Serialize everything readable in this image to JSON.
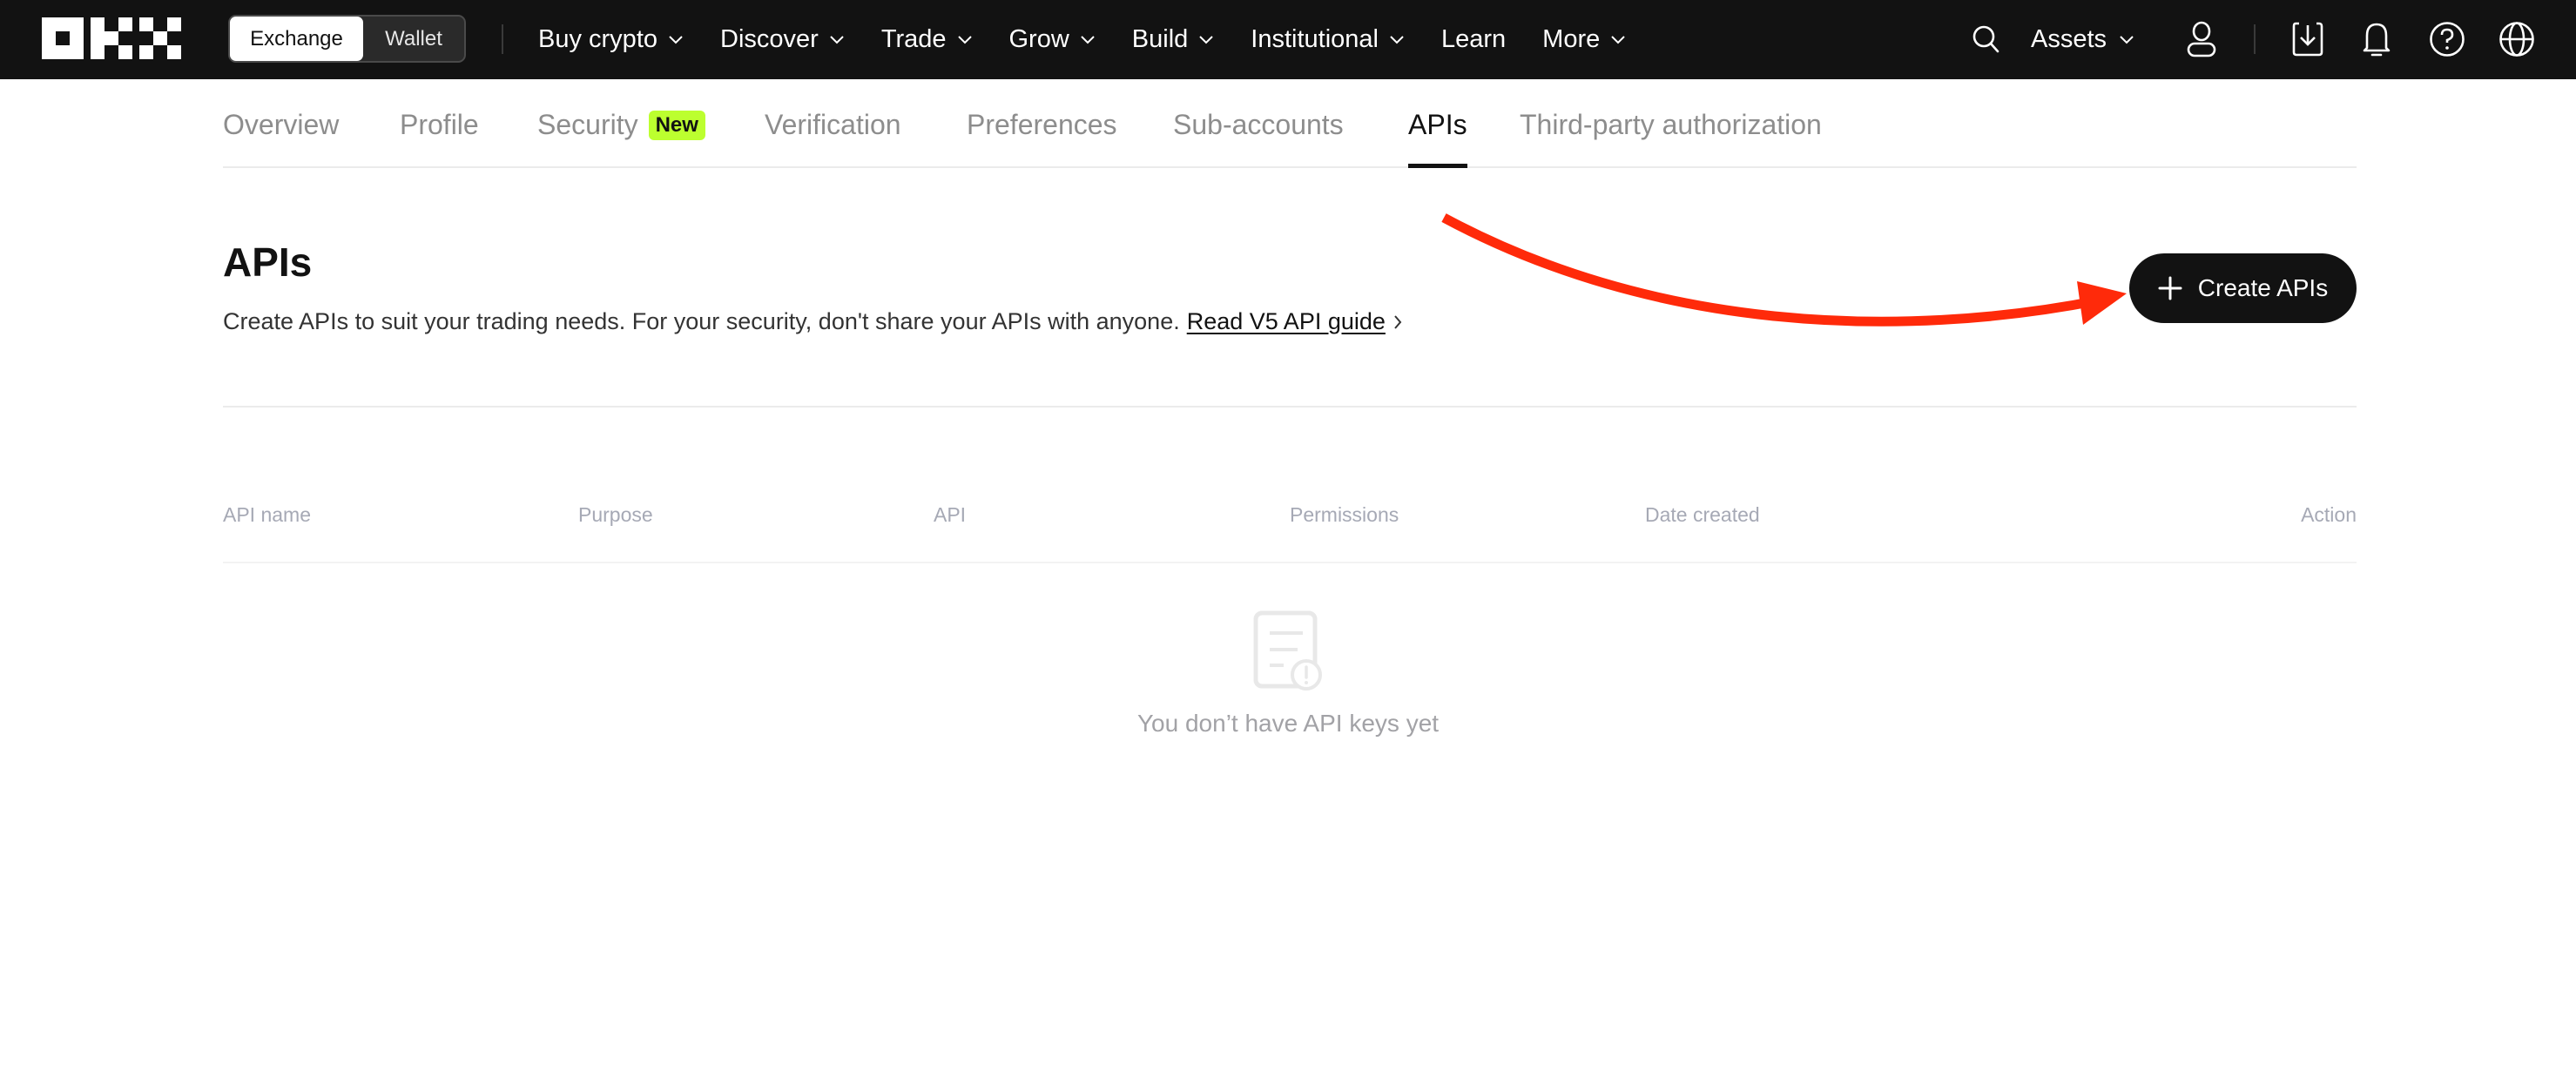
{
  "topnav": {
    "logo": "OKX",
    "mode_toggle": {
      "active": "Exchange",
      "inactive": "Wallet"
    },
    "menu": [
      {
        "label": "Buy crypto",
        "has_dropdown": true
      },
      {
        "label": "Discover",
        "has_dropdown": true
      },
      {
        "label": "Trade",
        "has_dropdown": true
      },
      {
        "label": "Grow",
        "has_dropdown": true
      },
      {
        "label": "Build",
        "has_dropdown": true
      },
      {
        "label": "Institutional",
        "has_dropdown": true
      },
      {
        "label": "Learn",
        "has_dropdown": false
      },
      {
        "label": "More",
        "has_dropdown": true
      }
    ],
    "assets_label": "Assets",
    "icons": [
      "search-icon",
      "user-icon",
      "download-icon",
      "bell-icon",
      "help-icon",
      "globe-icon"
    ]
  },
  "subtabs": [
    {
      "label": "Overview",
      "active": false
    },
    {
      "label": "Profile",
      "active": false
    },
    {
      "label": "Security",
      "active": false,
      "badge": "New"
    },
    {
      "label": "Verification",
      "active": false
    },
    {
      "label": "Preferences",
      "active": false
    },
    {
      "label": "Sub-accounts",
      "active": false
    },
    {
      "label": "APIs",
      "active": true
    },
    {
      "label": "Third-party authorization",
      "active": false
    }
  ],
  "page": {
    "title": "APIs",
    "description": "Create APIs to suit your trading needs. For your security, don't share your APIs with anyone.",
    "guide_link": "Read V5 API guide",
    "create_button": "Create APIs"
  },
  "table": {
    "columns": [
      "API name",
      "Purpose",
      "API",
      "Permissions",
      "Date created",
      "Action"
    ],
    "rows": [],
    "empty_text": "You don’t have API keys yet"
  },
  "colors": {
    "nav_bg": "#121212",
    "badge_new": "#bcff2f",
    "annotation_arrow": "#ff2a0a",
    "button_bg": "#121212"
  }
}
